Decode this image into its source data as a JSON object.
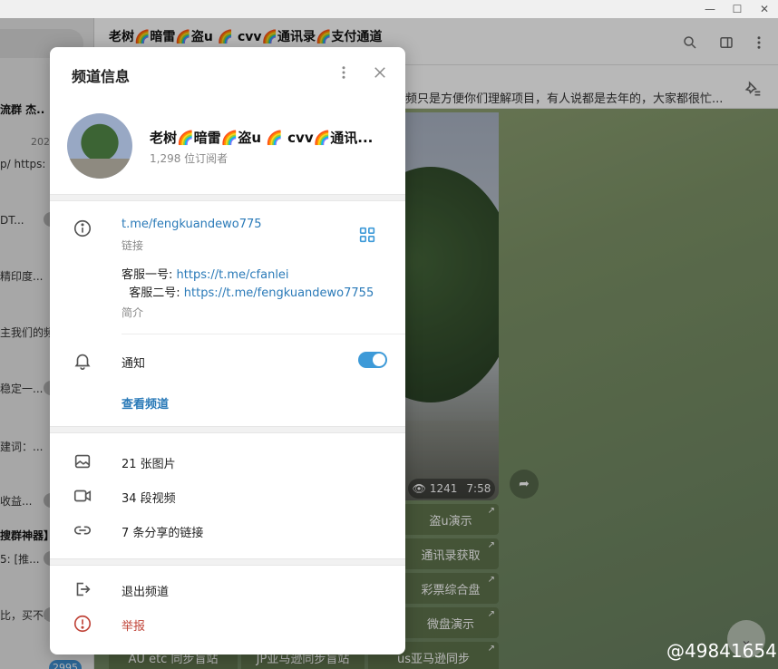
{
  "window": {
    "controls": [
      "minimize-icon",
      "maximize-icon",
      "close-icon"
    ]
  },
  "sidebar": {
    "rows": [
      {
        "text": "流群 杰..",
        "bold": true
      },
      {
        "text": "202",
        "date": true
      },
      {
        "text": "p/ https:",
        "bold": false
      },
      {
        "text": "DT...",
        "bold": false
      },
      {
        "text": "精印度...",
        "bold": false
      },
      {
        "text": "主我们的频",
        "bold": false
      },
      {
        "text": "稳定一...",
        "bold": false
      },
      {
        "text": "建词：...",
        "bold": false
      },
      {
        "text": "收益...",
        "bold": false
      },
      {
        "text": "搜群神器】",
        "bold": true
      },
      {
        "text": "5:  [推...",
        "bold": false
      },
      {
        "text": "比，买不...",
        "bold": false
      }
    ],
    "badge": "2995"
  },
  "chat": {
    "title": "老树🌈暗雷🌈盗u 🌈 cvv🌈通讯录🌈支付通道",
    "pinned_text": "视频只是方便你们理解项目，有人说都是去年的，大家都很忙...",
    "media_views": "1241",
    "media_duration": "7:58",
    "buttons": [
      {
        "label": "盗u演示"
      },
      {
        "label": "通讯录获取"
      },
      {
        "label": "彩票综合盘"
      },
      {
        "label": "微盘演示"
      },
      {
        "label": "AU etc 同步盲站"
      },
      {
        "label": "JP亚马逊同步盲站"
      },
      {
        "label": "us亚马逊同步"
      }
    ],
    "watermark": "@49841654"
  },
  "modal": {
    "title": "频道信息",
    "channel_name": "老树🌈暗雷🌈盗u 🌈 cvv🌈通讯...",
    "subscribers": "1,298 位订阅者",
    "link": "t.me/fengkuandewo775",
    "link_caption": "链接",
    "about": {
      "prefix1": "客服一号: ",
      "link1": "https://t.me/cfanlei",
      "prefix2": "  客服二号: ",
      "link2": "https://t.me/fengkuandewo7755"
    },
    "about_caption": "简介",
    "notifications_label": "通知",
    "notifications_on": true,
    "view_channel": "查看频道",
    "media": [
      {
        "label": "21 张图片",
        "icon": "photo-icon"
      },
      {
        "label": "34 段视频",
        "icon": "video-icon"
      },
      {
        "label": "7 条分享的链接",
        "icon": "link-icon"
      }
    ],
    "leave": "退出频道",
    "report": "举报",
    "colors": {
      "accent": "#2a7ab8",
      "toggle": "#3d9ad8",
      "danger": "#c0453a"
    }
  }
}
